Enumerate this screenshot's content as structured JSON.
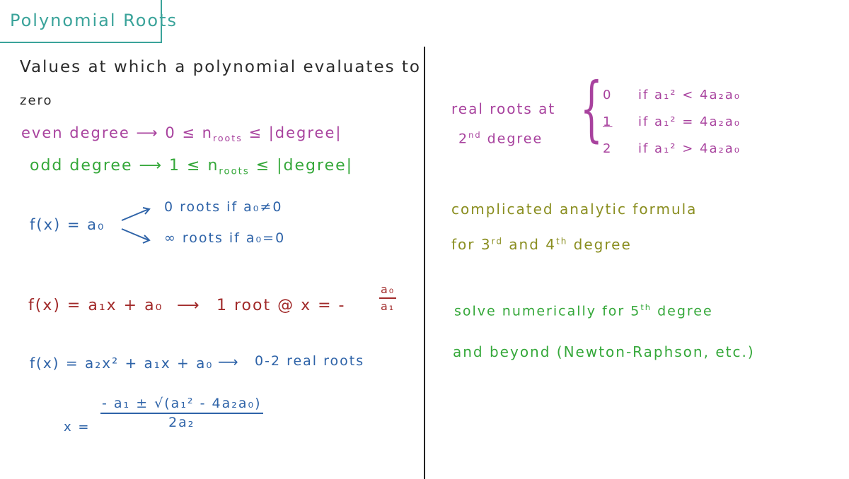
{
  "title": "Polynomial Roots",
  "definition": {
    "line1": "Values at which a polynomial evaluates to",
    "line2": "zero"
  },
  "even": {
    "label": "even degree",
    "range": "0 ≤ n",
    "sub": "roots",
    "rest": " ≤ |degree|"
  },
  "odd": {
    "label": "odd degree",
    "range": "1 ≤ n",
    "sub": "roots",
    "rest": " ≤ |degree|"
  },
  "constant": {
    "f": "f(x) = a₀",
    "case1": "0 roots if a₀≠0",
    "case2": "∞ roots if a₀=0"
  },
  "linear": {
    "f": "f(x) = a₁x + a₀",
    "result": "1 root @ x = -",
    "num": "a₀",
    "den": "a₁"
  },
  "quadratic": {
    "f": "f(x) = a₂x² + a₁x + a₀",
    "result": "0-2 real roots"
  },
  "formula": {
    "lhs": "x =",
    "num": "- a₁ ± √(a₁² - 4a₂a₀)",
    "den": "2a₂"
  },
  "real_roots": {
    "label1": "real roots at",
    "label2": "2",
    "label2_sup": "nd",
    "label2_rest": " degree",
    "cases": [
      {
        "n": "0",
        "cond": "if  a₁² < 4a₂a₀"
      },
      {
        "n": "1",
        "cond": "if  a₁² = 4a₂a₀"
      },
      {
        "n": "2",
        "cond": "if  a₁² > 4a₂a₀"
      }
    ]
  },
  "cubic": {
    "line1": "complicated analytic formula",
    "line2a": "for 3",
    "sup1": "rd",
    "line2b": " and 4",
    "sup2": "th",
    "line2c": " degree"
  },
  "quintic": {
    "line1a": "solve numerically for 5",
    "sup": "th",
    "line1b": " degree",
    "line2": "and beyond (Newton-Raphson, etc.)"
  }
}
